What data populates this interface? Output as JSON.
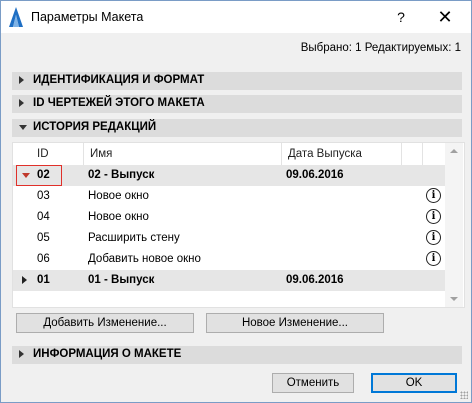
{
  "window": {
    "title": "Параметры Макета",
    "help_label": "?",
    "close_label": "✕"
  },
  "status": "Выбрано: 1 Редактируемых: 1",
  "sections": {
    "identification": "ИДЕНТИФИКАЦИЯ И ФОРМАТ",
    "drawing_ids": "ID ЧЕРТЕЖЕЙ ЭТОГО МАКЕТА",
    "revision_history": "ИСТОРИЯ РЕДАКЦИЙ",
    "layout_info": "ИНФОРМАЦИЯ О МАКЕТЕ"
  },
  "table": {
    "columns": {
      "id": "ID",
      "name": "Имя",
      "date": "Дата Выпуска"
    },
    "groups": [
      {
        "id": "02",
        "name": "02 - Выпуск",
        "date": "09.06.2016",
        "expanded": true,
        "changes": [
          {
            "id": "03",
            "name": "Новое окно"
          },
          {
            "id": "04",
            "name": "Новое окно"
          },
          {
            "id": "05",
            "name": "Расширить стену"
          },
          {
            "id": "06",
            "name": "Добавить новое окно"
          }
        ]
      },
      {
        "id": "01",
        "name": "01 - Выпуск",
        "date": "09.06.2016",
        "expanded": false
      }
    ],
    "info_glyph": "i"
  },
  "buttons": {
    "add_change": "Добавить Изменение...",
    "new_change": "Новое Изменение...",
    "cancel": "Отменить",
    "ok": "OK"
  },
  "colors": {
    "highlight": "#e0302a",
    "section_bg": "#dcdcdc",
    "group_row_bg": "#e6e6e6",
    "primary_border": "#0078d7"
  },
  "icons": {
    "app": "archicad-icon",
    "info": "info-icon",
    "expand": "triangle-icon"
  }
}
